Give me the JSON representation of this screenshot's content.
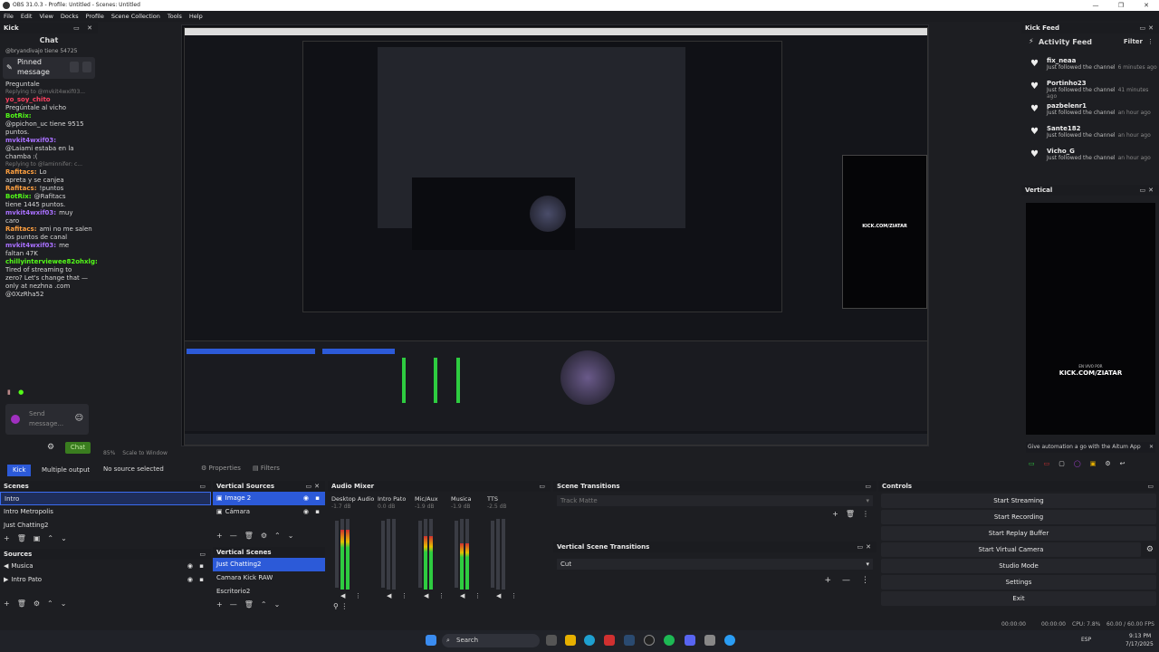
{
  "window": {
    "title": "OBS 31.0.3 - Profile: Untitled - Scenes: Untitled"
  },
  "menu": [
    "File",
    "Edit",
    "View",
    "Docks",
    "Profile",
    "Scene Collection",
    "Tools",
    "Help"
  ],
  "chat_dock": {
    "title": "Kick",
    "heading": "Chat",
    "top_line": "@bryandivajo tiene 54725",
    "pinned_label": "Pinned message",
    "lines": [
      {
        "type": "text",
        "text": "Preguntale"
      },
      {
        "type": "reply",
        "text": "Replying to @mvkit4wxif03..."
      },
      {
        "type": "msg",
        "user": "yo_soy_chito",
        "cls": "u-red",
        "text": ""
      },
      {
        "type": "text",
        "text": "Pregúntale al vicho"
      },
      {
        "type": "msg",
        "user": "BotRix:",
        "cls": "u-green",
        "text": ""
      },
      {
        "type": "text",
        "text": "@ppichon_uc tiene 9515"
      },
      {
        "type": "text",
        "text": "puntos."
      },
      {
        "type": "msg",
        "user": "mvkit4wxif03:",
        "cls": "u-purple",
        "text": ""
      },
      {
        "type": "text",
        "text": "@Laiami estaba en la"
      },
      {
        "type": "text",
        "text": "chamba :("
      },
      {
        "type": "reply",
        "text": "Replying to @laminnifer: c..."
      },
      {
        "type": "msg",
        "user": "Rafitacs:",
        "cls": "u-orange",
        "text": "Lo"
      },
      {
        "type": "text",
        "text": "apreta y se canjea"
      },
      {
        "type": "msg",
        "user": "Rafitacs:",
        "cls": "u-orange",
        "text": "!puntos"
      },
      {
        "type": "msg",
        "user": "BotRix:",
        "cls": "u-green",
        "text": "@Rafitacs"
      },
      {
        "type": "text",
        "text": "tiene 1445 puntos."
      },
      {
        "type": "msg",
        "user": "mvkit4wxif03:",
        "cls": "u-purple",
        "text": "muy"
      },
      {
        "type": "text",
        "text": "caro"
      },
      {
        "type": "msg",
        "user": "Rafitacs:",
        "cls": "u-orange",
        "text": "ami no me salen"
      },
      {
        "type": "text",
        "text": "los puntos de canal"
      },
      {
        "type": "msg",
        "user": "mvkit4wxif03:",
        "cls": "u-purple",
        "text": "me"
      },
      {
        "type": "text",
        "text": "faltan 47K"
      },
      {
        "type": "msg",
        "user": "chillyinterviewee82ohxlg:",
        "cls": "u-green",
        "text": ""
      },
      {
        "type": "text",
        "text": "Tired of streaming to"
      },
      {
        "type": "text",
        "text": "zero? Let's change that —"
      },
      {
        "type": "text",
        "text": "only at nezhna .com"
      },
      {
        "type": "text",
        "text": "@0XzRha52"
      }
    ],
    "send_placeholder": "Send message...",
    "chat_button": "Chat",
    "tab_kick": "Kick",
    "tab_multiple": "Multiple output"
  },
  "preview_toolbar": {
    "no_source": "No source selected",
    "properties": "Properties",
    "filters": "Filters"
  },
  "scenes": {
    "title": "Scenes",
    "items": [
      "Intro",
      "Intro Metropolis",
      "Just Chatting2"
    ],
    "selected": 0
  },
  "sources": {
    "title": "Sources",
    "items": [
      "Musica",
      "Intro Pato"
    ]
  },
  "vertical_sources": {
    "title": "Vertical Sources",
    "items": [
      "Image 2",
      "Cámara"
    ]
  },
  "vertical_scenes": {
    "title": "Vertical Scenes",
    "items": [
      "Just Chatting2",
      "Camara Kick RAW",
      "Escritorio2"
    ]
  },
  "audio_mixer": {
    "title": "Audio Mixer",
    "channels": [
      {
        "name": "Desktop Audio",
        "db": "-1.7 dB",
        "level": 0.85
      },
      {
        "name": "Intro Pato",
        "db": "0.0 dB",
        "level": 0.0
      },
      {
        "name": "Mic/Aux",
        "db": "-1.9 dB",
        "level": 0.75
      },
      {
        "name": "Musica",
        "db": "-1.9 dB",
        "level": 0.65
      },
      {
        "name": "TTS",
        "db": "-2.5 dB",
        "level": 0.0
      }
    ],
    "scale": [
      "5",
      "0",
      "-5",
      "-10",
      "-15",
      "-20",
      "-25",
      "-30",
      "-35",
      "-40",
      "-45",
      "-50",
      "-55",
      "-60"
    ]
  },
  "scene_transitions": {
    "title": "Scene Transitions",
    "value": "Track Matte"
  },
  "vertical_transitions": {
    "title": "Vertical Scene Transitions",
    "value": "Cut"
  },
  "controls": {
    "title": "Controls",
    "buttons": [
      "Start Streaming",
      "Start Recording",
      "Start Replay Buffer",
      "Start Virtual Camera",
      "Studio Mode",
      "Settings",
      "Exit"
    ]
  },
  "kick_feed": {
    "title": "Kick Feed",
    "heading": "Activity Feed",
    "filter": "Filter",
    "items": [
      {
        "name": "fix_neaa",
        "text": "Just followed the channel",
        "time": "6 minutes ago"
      },
      {
        "name": "Portinho23",
        "text": "Just followed the channel",
        "time": "41 minutes ago"
      },
      {
        "name": "pazbelenr1",
        "text": "Just followed the channel",
        "time": "an hour ago"
      },
      {
        "name": "Sante182",
        "text": "Just followed the channel",
        "time": "an hour ago"
      },
      {
        "name": "Vicho_G",
        "text": "Just followed the channel",
        "time": "an hour ago"
      }
    ]
  },
  "vertical_dock": {
    "title": "Vertical",
    "overlay_small": "EN VIVO POR",
    "overlay_big": "KICK.COM/ZIATAR",
    "aitum_banner": "Give automation a go with the Aitum App"
  },
  "status": {
    "time1": "00:00:00",
    "time2": "00:00:00",
    "cpu": "CPU: 7.8%",
    "fps": "60.00 / 60.00 FPS"
  },
  "taskbar": {
    "search": "Search",
    "lang": "ESP",
    "time": "9:13 PM",
    "date": "7/17/2025"
  },
  "preview_mini": {
    "zoom": "85%",
    "scale": "Scale to Window"
  },
  "colors": {
    "accent": "#2c5ad8",
    "kick_green": "#53fc18",
    "bg": "#1d1e22"
  }
}
